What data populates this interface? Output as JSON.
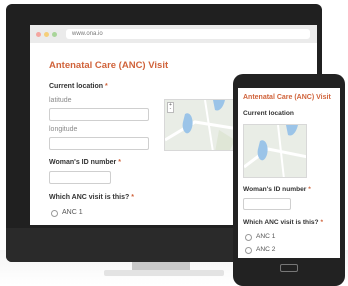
{
  "browser": {
    "url": "www.ona.io",
    "dot_colors": [
      "#f4a6a0",
      "#f5cf7a",
      "#a9d59a"
    ]
  },
  "form": {
    "title": "Antenatal Care (ANC) Visit",
    "current_location_label": "Current location",
    "required_marker": "*",
    "latitude_label": "latitude",
    "longitude_label": "longitude",
    "woman_id_label": "Woman's ID number",
    "anc_visit_question": "Which ANC visit is this?",
    "options": [
      "ANC 1",
      "ANC 2"
    ]
  },
  "colors": {
    "accent": "#d0633b",
    "map_water": "#9bc4e8",
    "map_land": "#e9ede6"
  }
}
